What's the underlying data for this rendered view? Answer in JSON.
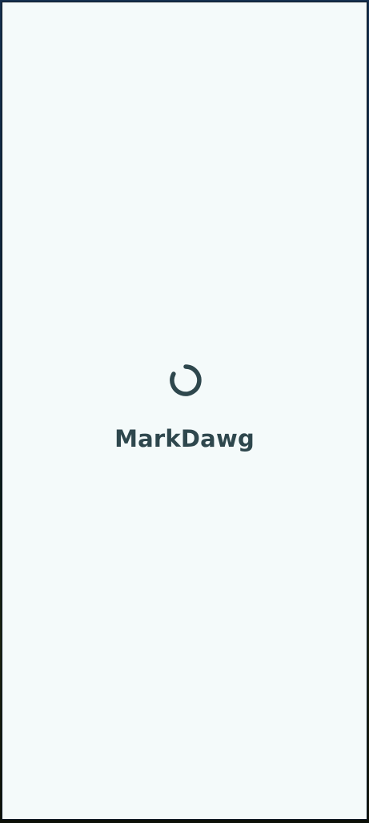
{
  "app": {
    "name": "MarkDawg"
  },
  "loading": {
    "indicator_icon": "spinner-icon"
  },
  "colors": {
    "background": "#f4fafa",
    "foreground": "#2e474d",
    "frame": "#0e1a26"
  }
}
